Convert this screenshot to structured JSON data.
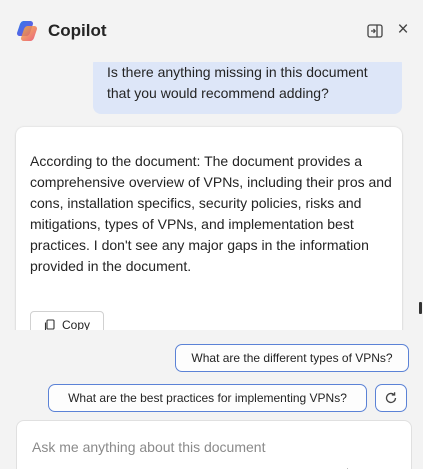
{
  "header": {
    "title": "Copilot",
    "dock_icon": "dock-panel-icon",
    "close_label": "×"
  },
  "chat": {
    "user_message": "Is there anything missing in this document that you would recommend adding?",
    "bot_message": "According to the document: The document provides a comprehensive overview of VPNs, including their pros and cons, installation specifics, security policies, risks and mitigations, types of VPNs, and implementation best practices. I don't see any major gaps in the information provided in the document.",
    "copy_label": "Copy"
  },
  "suggestions": [
    "What are the different types of VPNs?",
    "What are the best practices for implementing VPNs?"
  ],
  "input": {
    "placeholder": "Ask me anything about this document"
  },
  "colors": {
    "accent": "#5b82d6",
    "user_bubble": "#dde6f8",
    "background": "#f3f3f3"
  }
}
